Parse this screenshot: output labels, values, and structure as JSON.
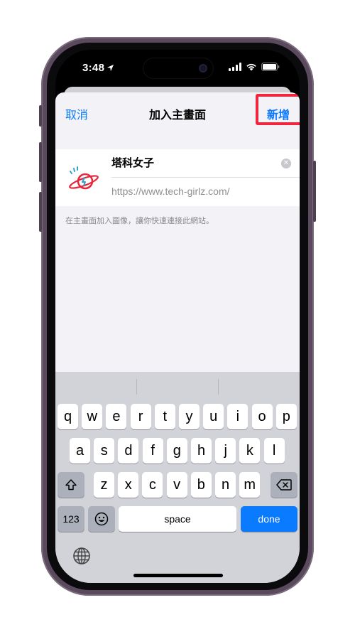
{
  "status_bar": {
    "time": "3:48"
  },
  "nav": {
    "cancel_label": "取消",
    "title": "加入主畫面",
    "add_label": "新增"
  },
  "bookmark": {
    "name_value": "塔科女子",
    "url": "https://www.tech-girlz.com/",
    "hint": "在主畫面加入圖像，讓你快速連接此網站。"
  },
  "keyboard": {
    "row1": [
      "q",
      "w",
      "e",
      "r",
      "t",
      "y",
      "u",
      "i",
      "o",
      "p"
    ],
    "row2": [
      "a",
      "s",
      "d",
      "f",
      "g",
      "h",
      "j",
      "k",
      "l"
    ],
    "row3": [
      "z",
      "x",
      "c",
      "v",
      "b",
      "n",
      "m"
    ],
    "numbers_label": "123",
    "space_label": "space",
    "done_label": "done"
  },
  "colors": {
    "accent": "#0a7aff",
    "highlight": "#f0263f",
    "logo_red": "#e8263a",
    "logo_blue": "#2ea3c9"
  }
}
